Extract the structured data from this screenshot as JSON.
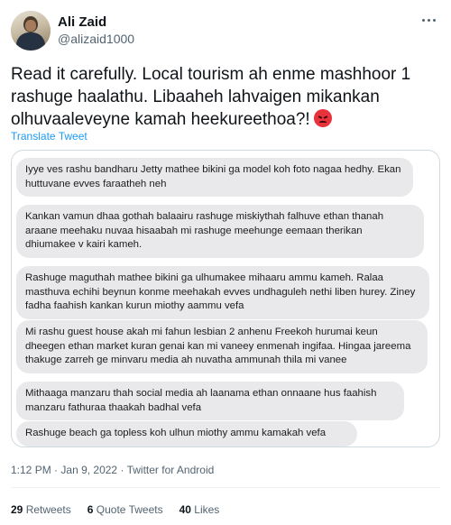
{
  "author": {
    "name": "Ali Zaid",
    "handle": "@alizaid1000"
  },
  "tweet": {
    "text": "Read it carefully. Local tourism ah enme mashhoor 1 rashuge haalathu. Libaaheh lahvaigen mikankan olhuvaaleveyne kamah heekureethoa?!",
    "emoji": "pouting-face",
    "translate_label": "Translate Tweet"
  },
  "messages": [
    "Iyye ves rashu bandharu Jetty mathee bikini ga model koh foto nagaa hedhy. Ekan huttuvane evves faraatheh neh",
    "Kankan vamun dhaa gothah balaairu rashuge miskiythah falhuve ethan thanah araane meehaku nuvaa hisaabah mi rashuge meehunge eemaan therikan dhiumakee v kairi kameh.",
    "Rashuge maguthah mathee bikini ga ulhumakee mihaaru ammu kameh. Ralaa masthuva echihi beynun konme meehakah evves undhaguleh nethi liben hurey. Ziney fadha faahish kankan kurun miothy aammu vefa",
    "Mi rashu guest house  akah mi fahun lesbian 2 anhenu Freekoh hurumai keun dheegen ethan market kuran genai kan mi vaneey enmenah ingifaa. Hingaa jareema thakuge zarreh ge minvaru media ah nuvatha ammunah thila mi vanee",
    "Mithaaga manzaru thah social media ah laanama ethan onnaane hus faahish manzaru fathuraa thaakah badhal vefa",
    "Rashuge beach ga topless koh ulhun miothy ammu kamakah vefa"
  ],
  "meta": {
    "time": "1:12 PM",
    "separator": "·",
    "date": "Jan 9, 2022",
    "source": "Twitter for Android"
  },
  "stats": {
    "retweets_count": "29",
    "retweets_label": "Retweets",
    "quotes_count": "6",
    "quotes_label": "Quote Tweets",
    "likes_count": "40",
    "likes_label": "Likes"
  }
}
